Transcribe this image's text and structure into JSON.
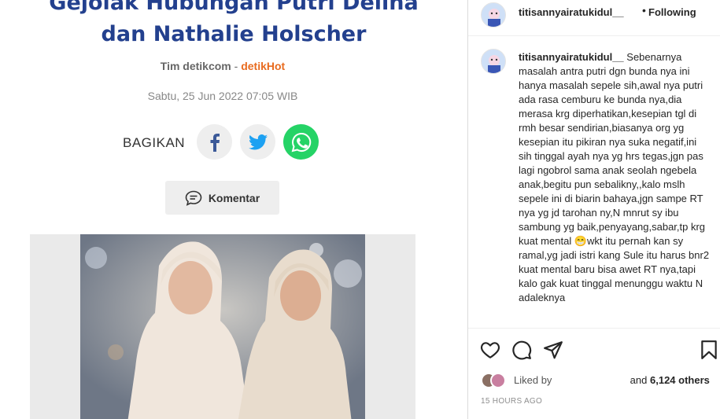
{
  "article": {
    "headline_line1": "Gejolak Hubungan Putri Delina",
    "headline_line2": "dan Nathalie Holscher",
    "author": "Tim detikcom",
    "separator": "-",
    "source": "detikHot",
    "date": "Sabtu, 25 Jun 2022 07:05 WIB",
    "share_label": "BAGIKAN",
    "comment_label": "Komentar"
  },
  "post": {
    "username": "titisannyairatukidul__",
    "separator_dot": "•",
    "follow_state": "Following",
    "caption_username": "titisannyairatukidul__",
    "caption_text": "Sebenarnya masalah antra putri dgn bunda nya ini hanya masalah sepele sih,awal nya putri ada rasa cemburu ke bunda nya,dia merasa krg diperhatikan,kesepian tgl di rmh besar sendirian,biasanya org yg kesepian itu pikiran nya suka negatif,ini sih tinggal ayah nya yg hrs tegas,jgn pas lagi ngobrol sama anak seolah ngebela anak,begitu pun sebalikny,,kalo mslh sepele ini di biarin bahaya,jgn sampe RT nya yg jd tarohan ny,N mnrut sy ibu sambung yg baik,penyayang,sabar,tp krg kuat mental 😁wkt itu pernah kan sy ramal,yg jadi istri kang Sule itu harus bnr2 kuat mental baru bisa awet RT nya,tapi kalo gak kuat tinggal menunggu waktu N adaleknya",
    "liked_by_label": "Liked by",
    "likes_suffix_pre": "and",
    "likes_count": "6,124 others",
    "timestamp": "15 HOURS AGO"
  },
  "icons": {
    "like": "heart-icon",
    "comment": "comment-icon",
    "share": "paper-plane-icon",
    "save": "bookmark-icon",
    "facebook": "facebook-icon",
    "twitter": "twitter-icon",
    "whatsapp": "whatsapp-icon",
    "comment_bubble": "chat-bubble-icon"
  },
  "colors": {
    "headline": "#23408e",
    "brand": "#e86b1f",
    "facebook": "#3b5998",
    "twitter": "#1da1f2",
    "whatsapp": "#25d366"
  }
}
